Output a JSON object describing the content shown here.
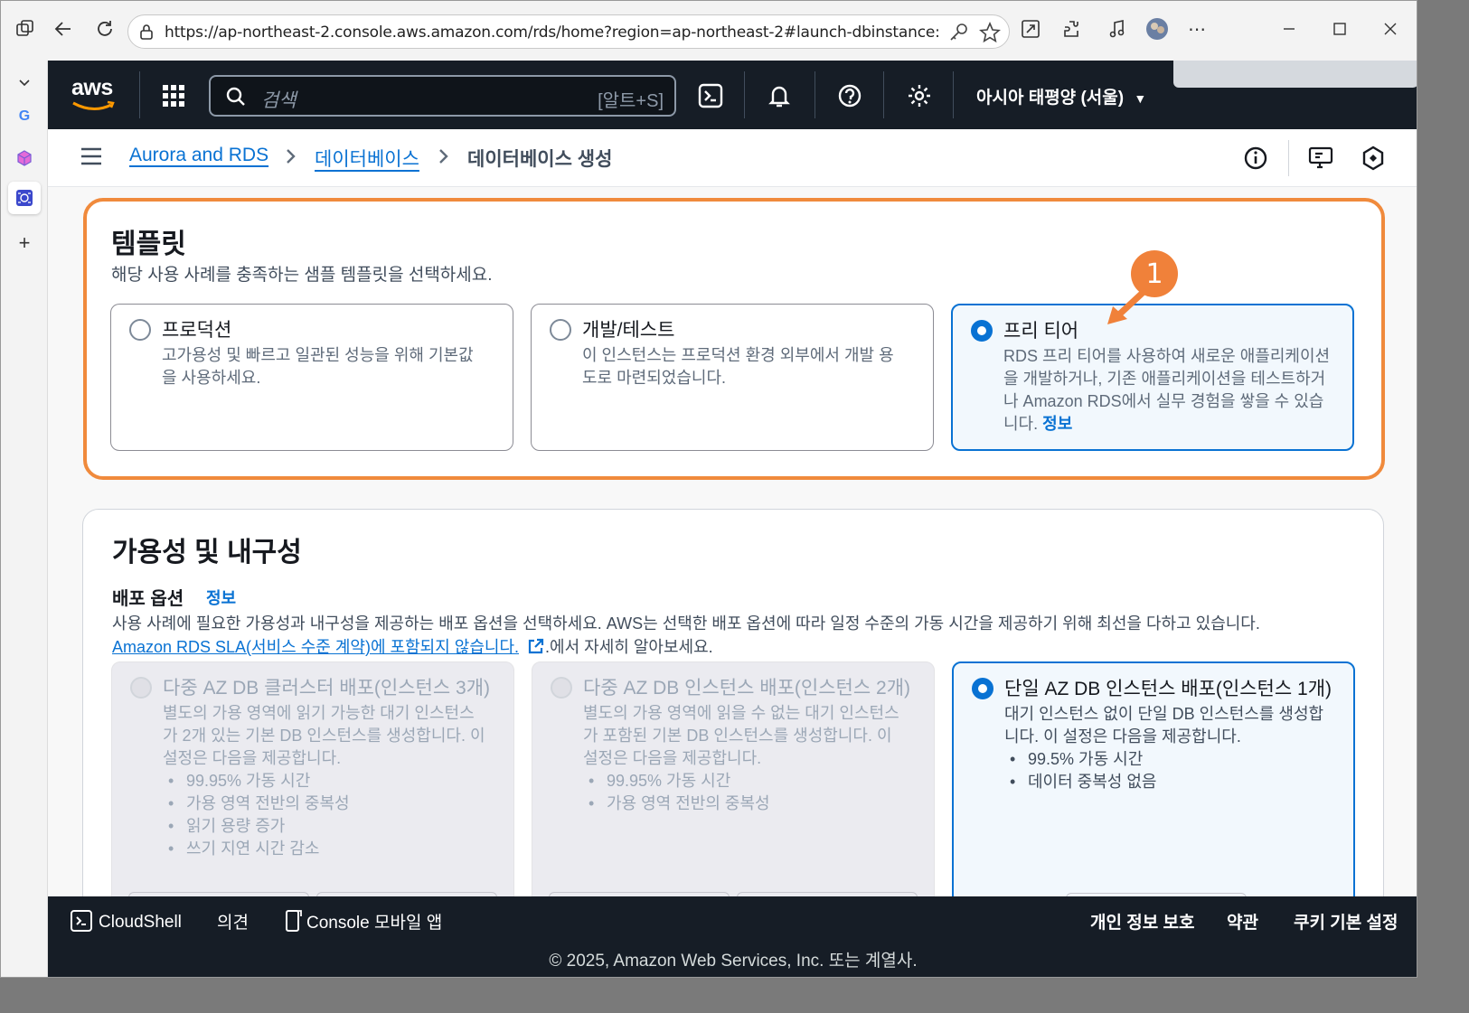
{
  "browser": {
    "url": "https://ap-northeast-2.console.aws.amazon.com/rds/home?region=ap-northeast-2#launch-dbinstance:"
  },
  "header": {
    "logo": "aws",
    "search_placeholder": "검색",
    "search_shortcut": "[알트+S]",
    "region": "아시아 태평양 (서울)"
  },
  "breadcrumb": {
    "items": [
      "Aurora and RDS",
      "데이터베이스",
      "데이터베이스 생성"
    ]
  },
  "templates": {
    "title": "템플릿",
    "description": "해당 사용 사례를 충족하는 샘플 템플릿을 선택하세요.",
    "options": [
      {
        "title": "프로덕션",
        "lines": [
          "고가용성 및 빠르고 일관된 성능을 위해 기본값",
          "을 사용하세요."
        ]
      },
      {
        "title": "개발/테스트",
        "lines": [
          "이 인스턴스는 프로덕션 환경 외부에서 개발 용",
          "도로 마련되었습니다."
        ]
      },
      {
        "title": "프리 티어",
        "lines": [
          "RDS 프리 티어를 사용하여 새로운 애플리케이션",
          "을 개발하거나, 기존 애플리케이션을 테스트하거",
          "나 Amazon RDS에서 실무 경험을 쌓을 수 있습"
        ],
        "last_line": "니다.",
        "info": "정보"
      }
    ],
    "annotation_number": "1"
  },
  "availability": {
    "title": "가용성 및 내구성",
    "deploy_label": "배포 옵션",
    "info": "정보",
    "desc_line1": "사용 사례에 필요한 가용성과 내구성을 제공하는 배포 옵션을 선택하세요. AWS는 선택한 배포 옵션에 따라 일정 수준의 가동 시간을 제공하기 위해 최선을 다하고 있습니다.",
    "sla_link": "Amazon RDS SLA(서비스 수준 계약)에 포함되지 않습니다.",
    "sla_suffix": ".에서 자세히 알아보세요.",
    "options": [
      {
        "title": "다중 AZ DB 클러스터 배포(인스턴스 3개)",
        "lines": [
          "별도의 가용 영역에 읽기 가능한 대기 인스턴스",
          "가 2개 있는 기본 DB 인스턴스를 생성합니다. 이",
          "설정은 다음을 제공합니다."
        ],
        "bullets": [
          "99.95% 가동 시간",
          "가용 영역 전반의 중복성",
          "읽기 용량 증가",
          "쓰기 지연 시간 감소"
        ]
      },
      {
        "title": "다중 AZ DB 인스턴스 배포(인스턴스 2개)",
        "lines": [
          "별도의 가용 영역에 읽을 수 없는 대기 인스턴스",
          "가 포함된 기본 DB 인스턴스를 생성합니다. 이",
          "설정은 다음을 제공합니다."
        ],
        "bullets": [
          "99.95% 가동 시간",
          "가용 영역 전반의 중복성"
        ]
      },
      {
        "title": "단일 AZ DB 인스턴스 배포(인스턴스 1개)",
        "lines": [
          "대기 인스턴스 없이 단일 DB 인스턴스를 생성합",
          "니다. 이 설정은 다음을 제공합니다."
        ],
        "bullets": [
          "99.5% 가동 시간",
          "데이터 중복성 없음"
        ]
      }
    ]
  },
  "footer": {
    "cloudshell": "CloudShell",
    "feedback": "의견",
    "mobile_app": "Console 모바일 앱",
    "privacy": "개인 정보 보호",
    "terms": "약관",
    "cookies": "쿠키 기본 설정",
    "copyright": "© 2025, Amazon Web Services, Inc. 또는 계열사."
  }
}
